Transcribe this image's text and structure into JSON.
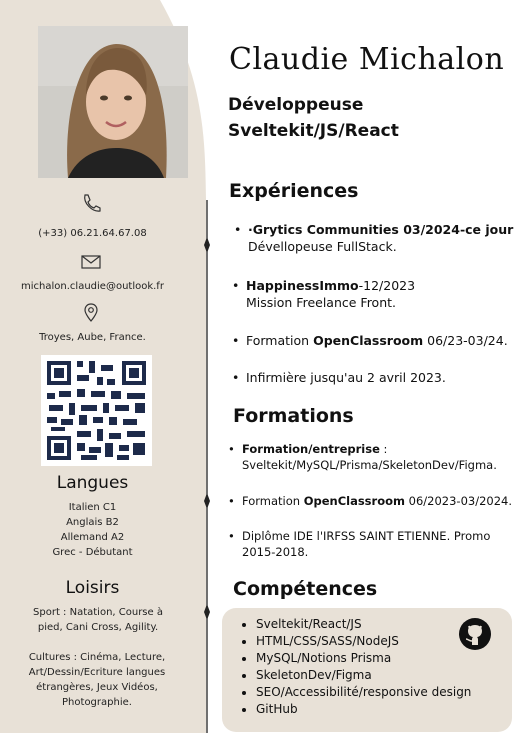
{
  "sidebar": {
    "phone": "(+33) 06.21.64.67.08",
    "email": "michalon.claudie@outlook.fr",
    "location": "Troyes, Aube, France.",
    "languages_title": "Langues",
    "languages": [
      "Italien C1",
      "Anglais B2",
      "Allemand A2",
      "Grec - Débutant"
    ],
    "hobbies_title": "Loisirs",
    "hobbies_sport": "Sport : Natation, Course à pied, Cani Cross, Agility.",
    "hobbies_culture": "Cultures : Cinéma, Lecture, Art/Dessin/Ecriture langues étrangères, Jeux Vidéos, Photographie."
  },
  "header": {
    "name": "Claudie Michalon",
    "role_line1": "Développeuse",
    "role_line2": "Sveltekit/JS/React"
  },
  "experiences": {
    "title": "Expériences",
    "items": [
      {
        "bold": "·Grytics Communities 03/2024-ce jour",
        "sub": "Dévellopeuse FullStack."
      },
      {
        "bold": "HappinessImmo",
        "rest": "-12/2023",
        "sub": "Mission Freelance Front."
      },
      {
        "pre": "Formation ",
        "bold": "OpenClassroom",
        "rest": " 06/23-03/24."
      },
      {
        "pre": "Infirmière jusqu'au 2 avril 2023."
      }
    ]
  },
  "formations": {
    "title": "Formations",
    "items": [
      {
        "bold": "Formation/entreprise",
        "rest": " :",
        "sub": "Sveltekit/MySQL/Prisma/SkeletonDev/Figma."
      },
      {
        "pre": "Formation ",
        "bold": "OpenClassroom",
        "rest": " 06/2023-03/2024."
      },
      {
        "pre": "Diplôme IDE l'IRFSS SAINT ETIENNE. Promo",
        "sub": "2015-2018."
      }
    ]
  },
  "skills": {
    "title": "Compétences",
    "items": [
      "Sveltekit/React/JS",
      "HTML/CSS/SASS/NodeJS",
      "MySQL/Notions Prisma",
      "SkeletonDev/Figma",
      "SEO/Accessibilité/responsive design",
      "GitHub"
    ]
  },
  "colors": {
    "sidebar": "#e8e1d7",
    "text": "#111111",
    "timeline": "#222222"
  },
  "icons": {
    "phone": "phone-icon",
    "email": "mail-icon",
    "location": "location-pin-icon",
    "github": "github-icon",
    "qr": "qr-code"
  }
}
